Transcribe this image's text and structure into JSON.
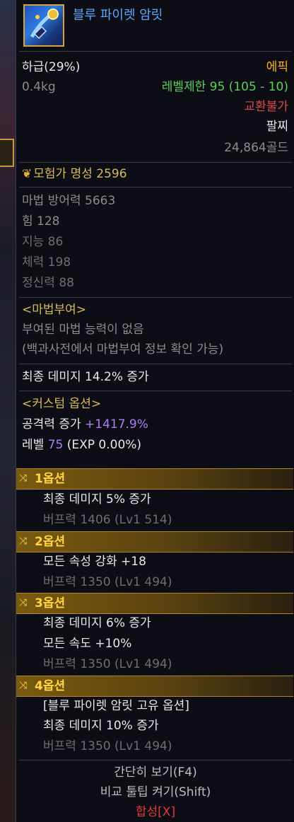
{
  "item": {
    "name": "블루 파이렛 암릿",
    "grade": "하급(29%)",
    "rarity": "에픽",
    "weight": "0.4kg",
    "level_limit": "레벨제한 95 (105 - 10)",
    "trade": "교환불가",
    "type": "팔찌",
    "price": "24,864골드"
  },
  "fame": "모험가 명성 2596",
  "stats": [
    "마법 방어력 5663",
    "힘 128",
    "지능 86",
    "체력 198",
    "정신력 88"
  ],
  "enchant": {
    "title": "<마법부여>",
    "none": "부여된 마법 능력이 없음",
    "hint": "(백과사전에서 마법부여 정보 확인 가능)"
  },
  "final_damage": "최종 데미지 14.2% 증가",
  "custom": {
    "title": "<커스텀 옵션>",
    "attack_label": "공격력 증가 ",
    "attack_value": "+1417.9%",
    "level_label": "레벨 ",
    "level_value": "75",
    "level_exp": " (EXP 0.00%)"
  },
  "options": [
    {
      "header": "1옵션",
      "lines": [
        "최종 데미지 5% 증가"
      ],
      "buff": "버프력 1406 (Lv1 514)"
    },
    {
      "header": "2옵션",
      "lines": [
        "모든 속성 강화 +18"
      ],
      "buff": "버프력 1350 (Lv1 494)"
    },
    {
      "header": "3옵션",
      "lines": [
        "최종 데미지 6% 증가",
        "모든 속도 +10%"
      ],
      "buff": "버프력 1350 (Lv1 494)"
    },
    {
      "header": "4옵션",
      "lines": [
        "[블루 파이렛 암릿 고유 옵션]",
        "최종 데미지 10% 증가"
      ],
      "buff": "버프력 1350 (Lv1 494)"
    }
  ],
  "footer": {
    "simple_view": "간단히 보기(F4)",
    "compare": "비교 툴팁 켜기(Shift)",
    "combine": "합성[X]"
  },
  "colors": {
    "title": "#5aa8ff",
    "epic": "#ffb020",
    "level_limit": "#5ad05a",
    "untradable": "#e04848",
    "option_header": "#ffd640",
    "custom_value": "#b07cf5"
  }
}
